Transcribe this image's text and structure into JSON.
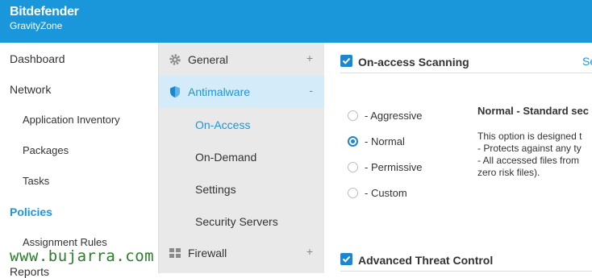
{
  "brand": {
    "name": "Bitdefender",
    "product": "GravityZone"
  },
  "left_nav": [
    {
      "label": "Dashboard"
    },
    {
      "label": "Network"
    },
    {
      "label": "Application Inventory"
    },
    {
      "label": "Packages"
    },
    {
      "label": "Tasks"
    },
    {
      "label": "Policies"
    },
    {
      "label": "Assignment Rules"
    },
    {
      "label": "Reports"
    }
  ],
  "policy_nav": {
    "general": {
      "label": "General",
      "toggle": "+"
    },
    "antimalware": {
      "label": "Antimalware",
      "toggle": "-"
    },
    "sub_items": [
      {
        "label": "On-Access"
      },
      {
        "label": "On-Demand"
      },
      {
        "label": "Settings"
      },
      {
        "label": "Security Servers"
      }
    ],
    "firewall": {
      "label": "Firewall",
      "toggle": "+"
    }
  },
  "content": {
    "on_access": {
      "label": "On-access Scanning",
      "checked": true,
      "link": "Se"
    },
    "radios": [
      {
        "label": "- Aggressive",
        "selected": false
      },
      {
        "label": "- Normal",
        "selected": true
      },
      {
        "label": "- Permissive",
        "selected": false
      },
      {
        "label": "- Custom",
        "selected": false
      }
    ],
    "description": {
      "title": "Normal - Standard sec",
      "lines": [
        "This option is designed t",
        "- Protects against any ty",
        "- All accessed files from",
        "zero risk files)."
      ]
    },
    "atc": {
      "label": "Advanced Threat Control",
      "checked": true
    }
  },
  "watermark": "www.bujarra.com",
  "colors": {
    "accent": "#1a96db",
    "header": "#1a96db",
    "watermark": "#2a7d2a"
  }
}
